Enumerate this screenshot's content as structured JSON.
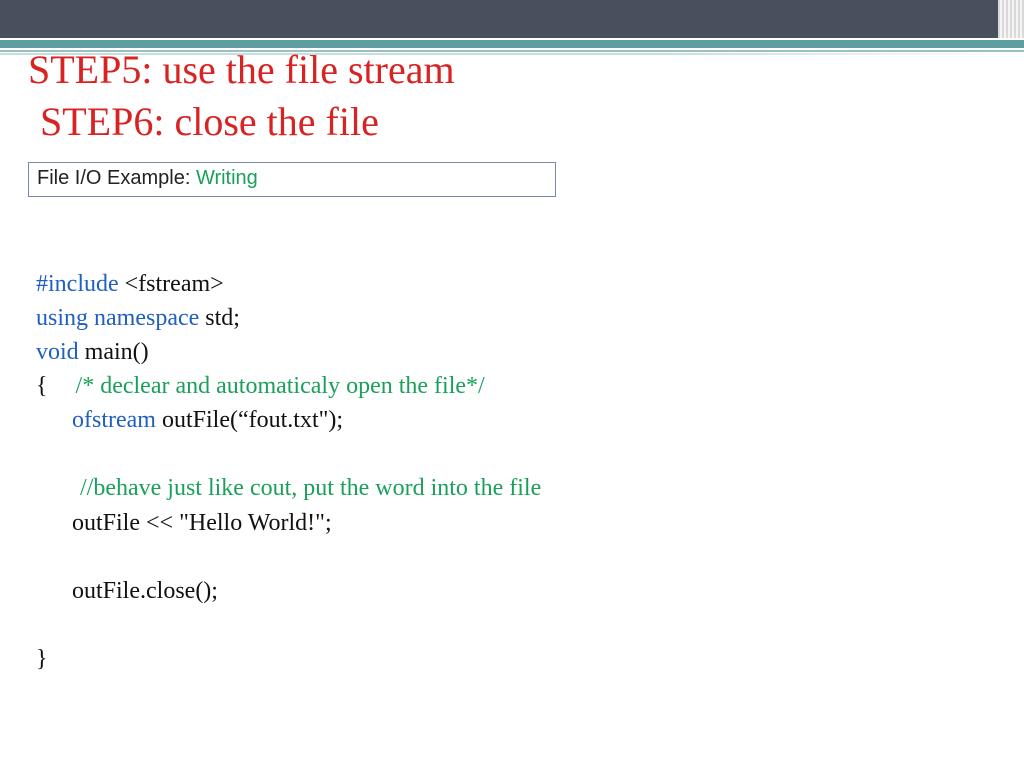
{
  "heading": {
    "line1": "STEP5: use the file stream",
    "line2": "STEP6: close the file"
  },
  "subbox": {
    "label": "File I/O Example: ",
    "mode": "Writing"
  },
  "code": {
    "l1a": "#include ",
    "l1b": "<fstream>",
    "l2a": "using namespace ",
    "l2b": "std;",
    "l3a": "void ",
    "l3b": "main()",
    "l4a": "{",
    "l4b": "/* declear and automaticaly open the file*/",
    "l5a": "ofstream ",
    "l5b": "outFile(“fout.txt\");",
    "l6": "//behave just like cout, put the word into  the file",
    "l7": "outFile << \"Hello World!\";",
    "l8": "outFile.close();",
    "l9": "}"
  }
}
